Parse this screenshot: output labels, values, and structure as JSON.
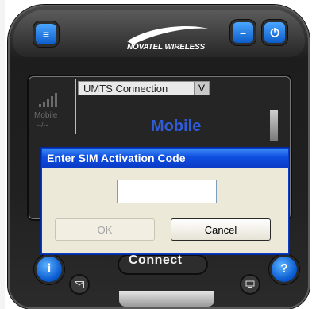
{
  "app": {
    "brand": "NOVATEL WIRELESS"
  },
  "screen": {
    "signal_label": "Mobile",
    "signal_sub": "--/--",
    "connection_type": "UMTS Connection",
    "dropdown_arrow": "V",
    "status": "Mobile"
  },
  "controls": {
    "connect_label": "Connect",
    "info_icon": "i",
    "help_icon": "?",
    "minimize_icon": "–",
    "power_icon": "⏻",
    "menu_icon": "≡"
  },
  "dialog": {
    "title": "Enter SIM Activation Code",
    "input_value": "",
    "ok_label": "OK",
    "cancel_label": "Cancel"
  },
  "colors": {
    "accent_blue": "#0c5cc8",
    "title_bar": "#0a3cc6",
    "status_text": "#2f5bd7"
  }
}
